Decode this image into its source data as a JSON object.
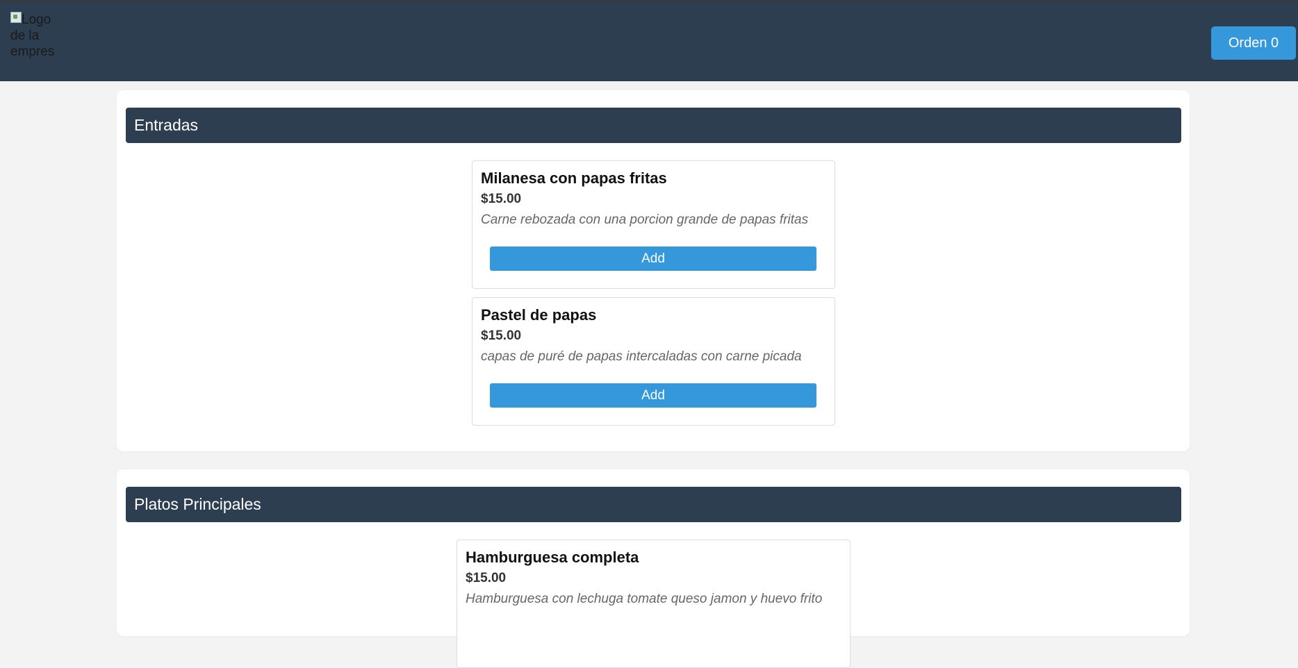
{
  "header": {
    "logo_alt": "Logo de la empresa",
    "order_button_label": "Orden 0"
  },
  "sections": [
    {
      "title": "Entradas",
      "items": [
        {
          "name": "Milanesa con papas fritas",
          "price": "$15.00",
          "description": "Carne rebozada con una porcion grande de papas fritas",
          "add_label": "Add"
        },
        {
          "name": "Pastel de papas",
          "price": "$15.00",
          "description": "capas de puré de papas intercaladas con carne picada",
          "add_label": "Add"
        }
      ]
    },
    {
      "title": "Platos Principales",
      "items": [
        {
          "name": "Hamburguesa completa",
          "price": "$15.00",
          "description": "Hamburguesa con lechuga tomate queso jamon y huevo frito"
        }
      ]
    }
  ],
  "colors": {
    "header_bg": "#2c3e50",
    "accent": "#3498db",
    "page_bg": "#f3f3f3"
  }
}
